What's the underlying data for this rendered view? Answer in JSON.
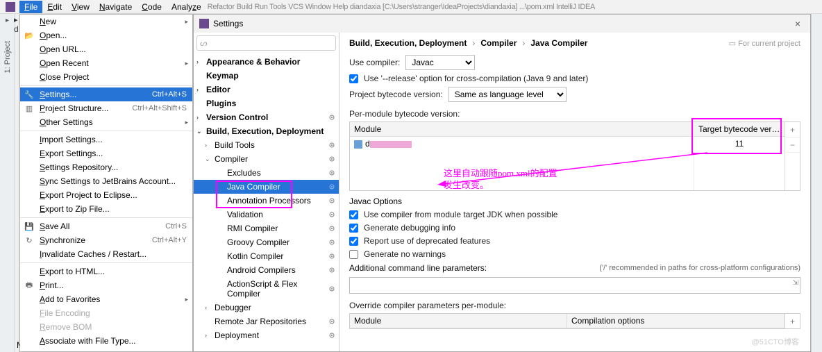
{
  "menubar": {
    "items": [
      "File",
      "Edit",
      "View",
      "Navigate",
      "Code",
      "Analyze"
    ],
    "tail": "Refactor   Build   Run   Tools   VCS   Window   Help        diandaxia [C:\\Users\\stranger\\IdeaProjects\\diandaxia]  ...\\pom.xml   IntelliJ IDEA"
  },
  "rail": {
    "label1": "1: Project",
    "tab": "d"
  },
  "fileMenu": {
    "items": [
      {
        "label": "New",
        "arrow": true
      },
      {
        "label": "Open...",
        "icon": "📂"
      },
      {
        "label": "Open URL..."
      },
      {
        "label": "Open Recent",
        "arrow": true
      },
      {
        "label": "Close Project"
      },
      {
        "sep": true
      },
      {
        "label": "Settings...",
        "shortcut": "Ctrl+Alt+S",
        "icon": "🔧",
        "sel": true
      },
      {
        "label": "Project Structure...",
        "shortcut": "Ctrl+Alt+Shift+S",
        "icon": "▥"
      },
      {
        "label": "Other Settings",
        "arrow": true
      },
      {
        "sep": true
      },
      {
        "label": "Import Settings..."
      },
      {
        "label": "Export Settings..."
      },
      {
        "label": "Settings Repository..."
      },
      {
        "label": "Sync Settings to JetBrains Account..."
      },
      {
        "label": "Export Project to Eclipse..."
      },
      {
        "label": "Export to Zip File..."
      },
      {
        "sep": true
      },
      {
        "label": "Save All",
        "shortcut": "Ctrl+S",
        "icon": "💾"
      },
      {
        "label": "Synchronize",
        "shortcut": "Ctrl+Alt+Y",
        "icon": "↻"
      },
      {
        "label": "Invalidate Caches / Restart..."
      },
      {
        "sep": true
      },
      {
        "label": "Export to HTML..."
      },
      {
        "label": "Print...",
        "icon": "🖶"
      },
      {
        "label": "Add to Favorites",
        "arrow": true
      },
      {
        "label": "File Encoding",
        "dis": true
      },
      {
        "label": "Remove BOM",
        "dis": true
      },
      {
        "label": "Associate with File Type..."
      }
    ]
  },
  "settings": {
    "title": "Settings",
    "searchIcon": "🔍",
    "tree": [
      {
        "label": "Appearance & Behavior",
        "bold": true,
        "tw": "›"
      },
      {
        "label": "Keymap",
        "bold": true
      },
      {
        "label": "Editor",
        "bold": true,
        "tw": "›"
      },
      {
        "label": "Plugins",
        "bold": true
      },
      {
        "label": "Version Control",
        "bold": true,
        "tw": "›",
        "gear": true
      },
      {
        "label": "Build, Execution, Deployment",
        "bold": true,
        "tw": "⌄"
      },
      {
        "label": "Build Tools",
        "d": 1,
        "tw": "›",
        "gear": true
      },
      {
        "label": "Compiler",
        "d": 1,
        "tw": "⌄",
        "gear": true
      },
      {
        "label": "Excludes",
        "d": 2,
        "gear": true
      },
      {
        "label": "Java Compiler",
        "d": 2,
        "sel": true,
        "gear": true
      },
      {
        "label": "Annotation Processors",
        "d": 2,
        "gear": true
      },
      {
        "label": "Validation",
        "d": 2,
        "gear": true
      },
      {
        "label": "RMI Compiler",
        "d": 2,
        "gear": true
      },
      {
        "label": "Groovy Compiler",
        "d": 2,
        "gear": true
      },
      {
        "label": "Kotlin Compiler",
        "d": 2,
        "gear": true
      },
      {
        "label": "Android Compilers",
        "d": 2,
        "gear": true
      },
      {
        "label": "ActionScript & Flex Compiler",
        "d": 2,
        "gear": true
      },
      {
        "label": "Debugger",
        "d": 1,
        "tw": "›"
      },
      {
        "label": "Remote Jar Repositories",
        "d": 1,
        "gear": true
      },
      {
        "label": "Deployment",
        "d": 1,
        "tw": "›",
        "gear": true
      }
    ],
    "breadcrumb": [
      "Build, Execution, Deployment",
      "Compiler",
      "Java Compiler"
    ],
    "projHint": "For current project",
    "useCompilerLbl": "Use compiler:",
    "useCompilerVal": "Javac",
    "releaseOpt": "Use '--release' option for cross-compilation (Java 9 and later)",
    "bytecodeLbl": "Project bytecode version:",
    "bytecodeVal": "Same as language level",
    "perModuleLbl": "Per-module bytecode version:",
    "modTable": {
      "col1": "Module",
      "col2": "Target bytecode versi...",
      "row1_name": "d",
      "row1_target": "11"
    },
    "javacTitle": "Javac Options",
    "cb1": "Use compiler from module target JDK when possible",
    "cb2": "Generate debugging info",
    "cb3": "Report use of deprecated features",
    "cb4": "Generate no warnings",
    "cmdLbl": "Additional command line parameters:",
    "cmdHint": "('/' recommended in paths for cross-platform configurations)",
    "overrideLbl": "Override compiler parameters per-module:",
    "overrideCols": [
      "Module",
      "Compilation options"
    ]
  },
  "annotation": {
    "text": "这里自动跟随pom.xml的配置\n发生改变。"
  },
  "watermark": "@51CTO博客",
  "m": "M"
}
